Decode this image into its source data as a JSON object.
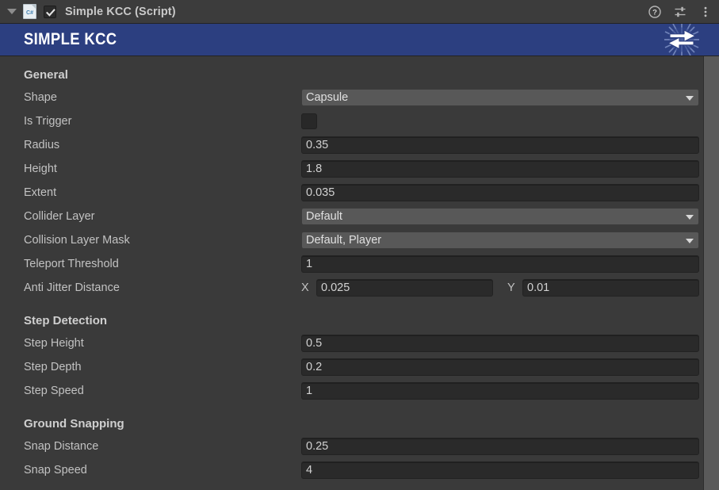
{
  "titlebar": {
    "foldout_icon": "triangle-down-icon",
    "script_icon": "csharp-script-icon",
    "enabled_checkbox": "checked",
    "title": "Simple KCC (Script)",
    "help_icon": "help-icon",
    "preset_icon": "preset-sliders-icon",
    "menu_icon": "kebab-menu-icon"
  },
  "banner": {
    "title": "SIMPLE KCC",
    "logo_icon": "fusion-swap-arrows-icon",
    "color": "#2c3f80"
  },
  "sections": [
    {
      "heading": "General",
      "rows": [
        {
          "label": "Shape",
          "type": "dropdown",
          "value": "Capsule"
        },
        {
          "label": "Is Trigger",
          "type": "checkbox",
          "value": ""
        },
        {
          "label": "Radius",
          "type": "input",
          "value": "0.35"
        },
        {
          "label": "Height",
          "type": "input",
          "value": "1.8"
        },
        {
          "label": "Extent",
          "type": "input",
          "value": "0.035"
        },
        {
          "label": "Collider Layer",
          "type": "dropdown",
          "value": "Default"
        },
        {
          "label": "Collision Layer Mask",
          "type": "dropdown",
          "value": "Default, Player"
        },
        {
          "label": "Teleport Threshold",
          "type": "input",
          "value": "1"
        },
        {
          "label": "Anti Jitter Distance",
          "type": "vector2",
          "axis_x": "X",
          "value_x": "0.025",
          "axis_y": "Y",
          "value_y": "0.01"
        }
      ]
    },
    {
      "heading": "Step Detection",
      "rows": [
        {
          "label": "Step Height",
          "type": "input",
          "value": "0.5"
        },
        {
          "label": "Step Depth",
          "type": "input",
          "value": "0.2"
        },
        {
          "label": "Step Speed",
          "type": "input",
          "value": "1"
        }
      ]
    },
    {
      "heading": "Ground Snapping",
      "rows": [
        {
          "label": "Snap Distance",
          "type": "input",
          "value": "0.25"
        },
        {
          "label": "Snap Speed",
          "type": "input",
          "value": "4"
        }
      ]
    }
  ]
}
